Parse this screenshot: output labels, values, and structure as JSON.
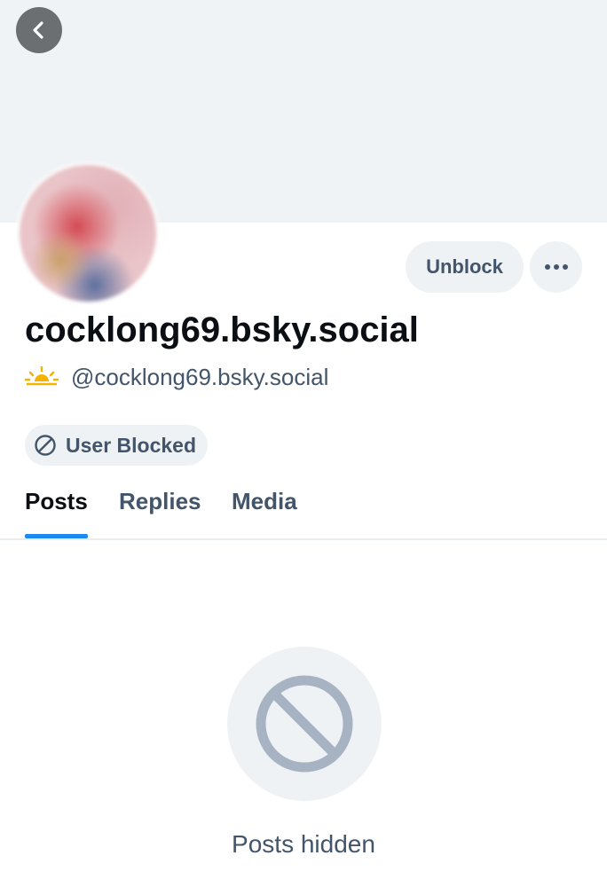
{
  "header": {
    "back_icon": "chevron-left-icon"
  },
  "profile": {
    "display_name": "cocklong69.bsky.social",
    "handle": "@cocklong69.bsky.social",
    "handle_prefix_icon": "sun-rising-icon",
    "unblock_label": "Unblock",
    "more_icon": "ellipsis-icon",
    "blocked_label": "User Blocked",
    "blocked_icon": "block-icon"
  },
  "tabs": [
    {
      "label": "Posts",
      "active": true
    },
    {
      "label": "Replies",
      "active": false
    },
    {
      "label": "Media",
      "active": false
    }
  ],
  "empty_state": {
    "icon": "block-icon",
    "message": "Posts hidden"
  },
  "colors": {
    "accent": "#1d8af2",
    "banner": "#f0f3f5",
    "muted_text": "#43556a"
  }
}
